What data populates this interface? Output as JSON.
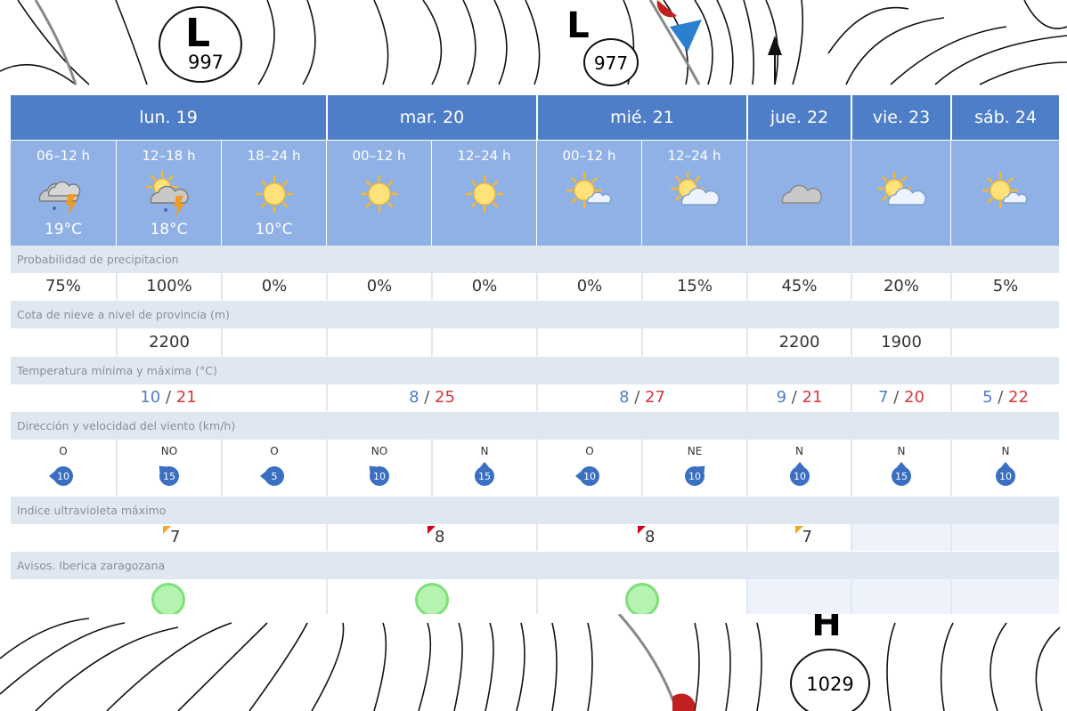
{
  "map": {
    "lows": [
      {
        "letter": "L",
        "pressure": "997"
      },
      {
        "letter": "L",
        "pressure": "977"
      }
    ],
    "highs": [
      {
        "letter": "H",
        "pressure": "1029"
      }
    ]
  },
  "days": [
    "lun. 19",
    "mar. 20",
    "mié. 21",
    "jue. 22",
    "vie. 23",
    "sáb. 24"
  ],
  "periods": [
    {
      "label": "06–12 h",
      "icon": "storm-cloud-icon",
      "temp": "19°C"
    },
    {
      "label": "12–18 h",
      "icon": "sun-storm-cloud-icon",
      "temp": "18°C"
    },
    {
      "label": "18–24 h",
      "icon": "sun-icon",
      "temp": "10°C"
    },
    {
      "label": "00–12 h",
      "icon": "sun-icon",
      "temp": ""
    },
    {
      "label": "12–24 h",
      "icon": "sun-icon",
      "temp": ""
    },
    {
      "label": "00–12 h",
      "icon": "sun-small-cloud-icon",
      "temp": ""
    },
    {
      "label": "12–24 h",
      "icon": "sun-cloud-icon",
      "temp": ""
    },
    {
      "label": "",
      "icon": "cloud-icon",
      "temp": ""
    },
    {
      "label": "",
      "icon": "sun-cloud-icon",
      "temp": ""
    },
    {
      "label": "",
      "icon": "sun-small-cloud-icon",
      "temp": ""
    }
  ],
  "sections": {
    "precip_label": "Probabilidad de precipitacion",
    "snow_label": "Cota de nieve a nivel de provincia (m)",
    "temp_label": "Temperatura mínima y máxima (°C)",
    "wind_label": "Dirección y velocidad del viento (km/h)",
    "uv_label": "Indice ultravioleta máximo",
    "avisos_label": "Avisos. Iberica zaragozana"
  },
  "precip": [
    "75%",
    "100%",
    "0%",
    "0%",
    "0%",
    "0%",
    "15%",
    "45%",
    "20%",
    "5%"
  ],
  "snow": [
    "",
    "2200",
    "",
    "",
    "",
    "",
    "",
    "2200",
    "1900",
    ""
  ],
  "temps": [
    {
      "min": "10",
      "max": "21"
    },
    {
      "min": "8",
      "max": "25"
    },
    {
      "min": "8",
      "max": "27"
    },
    {
      "min": "9",
      "max": "21"
    },
    {
      "min": "7",
      "max": "20"
    },
    {
      "min": "5",
      "max": "22"
    }
  ],
  "wind": [
    {
      "dir": "O",
      "speed": "10"
    },
    {
      "dir": "NO",
      "speed": "15"
    },
    {
      "dir": "O",
      "speed": "5"
    },
    {
      "dir": "NO",
      "speed": "10"
    },
    {
      "dir": "N",
      "speed": "15"
    },
    {
      "dir": "O",
      "speed": "10"
    },
    {
      "dir": "NE",
      "speed": "10"
    },
    {
      "dir": "N",
      "speed": "10"
    },
    {
      "dir": "N",
      "speed": "15"
    },
    {
      "dir": "N",
      "speed": "10"
    }
  ],
  "uv": [
    {
      "value": "7",
      "color": "#f5a623"
    },
    {
      "value": "8",
      "color": "#d0021b"
    },
    {
      "value": "8",
      "color": "#d0021b"
    },
    {
      "value": "7",
      "color": "#f5a623"
    },
    {
      "value": "",
      "color": ""
    },
    {
      "value": "",
      "color": ""
    }
  ],
  "avisos": [
    {
      "status": "green",
      "color": "#7ee07a"
    },
    {
      "status": "green",
      "color": "#7ee07a"
    },
    {
      "status": "green",
      "color": "#7ee07a"
    },
    {
      "status": "",
      "color": ""
    },
    {
      "status": "",
      "color": ""
    },
    {
      "status": "",
      "color": ""
    }
  ],
  "colors": {
    "header_day": "#4f7ec8",
    "header_period": "#8fb1e6",
    "section_bg": "#dfe8f1",
    "temp_min": "#4f7ec8",
    "temp_max": "#d9363e",
    "wind_badge": "#3a6fc2"
  }
}
